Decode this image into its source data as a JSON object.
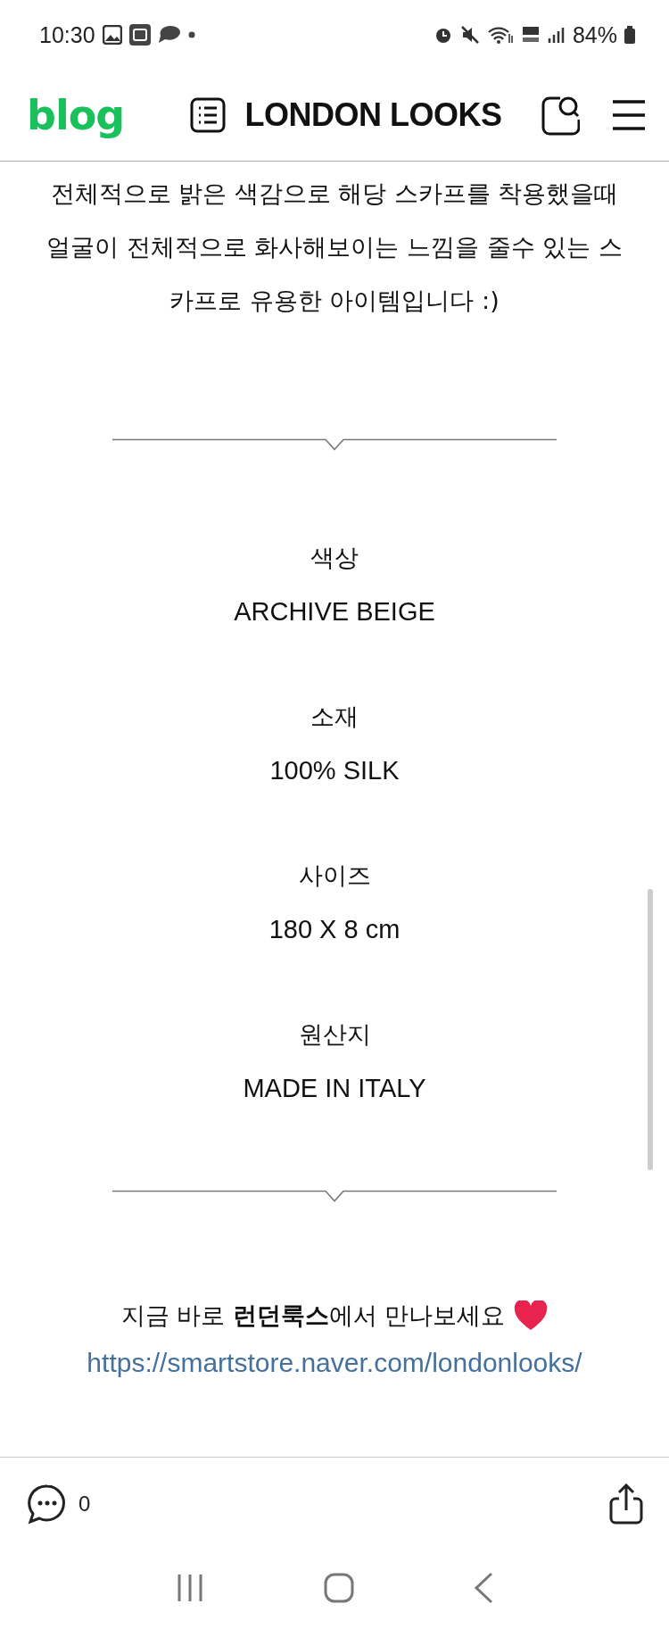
{
  "status_bar": {
    "time": "10:30",
    "battery": "84%"
  },
  "header": {
    "logo": "blog",
    "title": "LONDON LOOKS"
  },
  "intro_lines": [
    "전체적으로 밝은 색감으로 해당 스카프를 착용했을때",
    "얼굴이 전체적으로 화사해보이는 느낌을 줄수 있는 스카프로  유용한 아이템입니다 :)"
  ],
  "specs": [
    {
      "label": "색상",
      "value": "ARCHIVE BEIGE"
    },
    {
      "label": "소재",
      "value": "100% SILK"
    },
    {
      "label": "사이즈",
      "value": "180 X 8 cm"
    },
    {
      "label": "원산지",
      "value": "MADE IN ITALY"
    }
  ],
  "promo": "지금 바로 **런던룩스**에서 만나보세요",
  "link": "https://smartstore.naver.com/londonlooks/",
  "bottom_bar": {
    "comment_count": "0"
  }
}
